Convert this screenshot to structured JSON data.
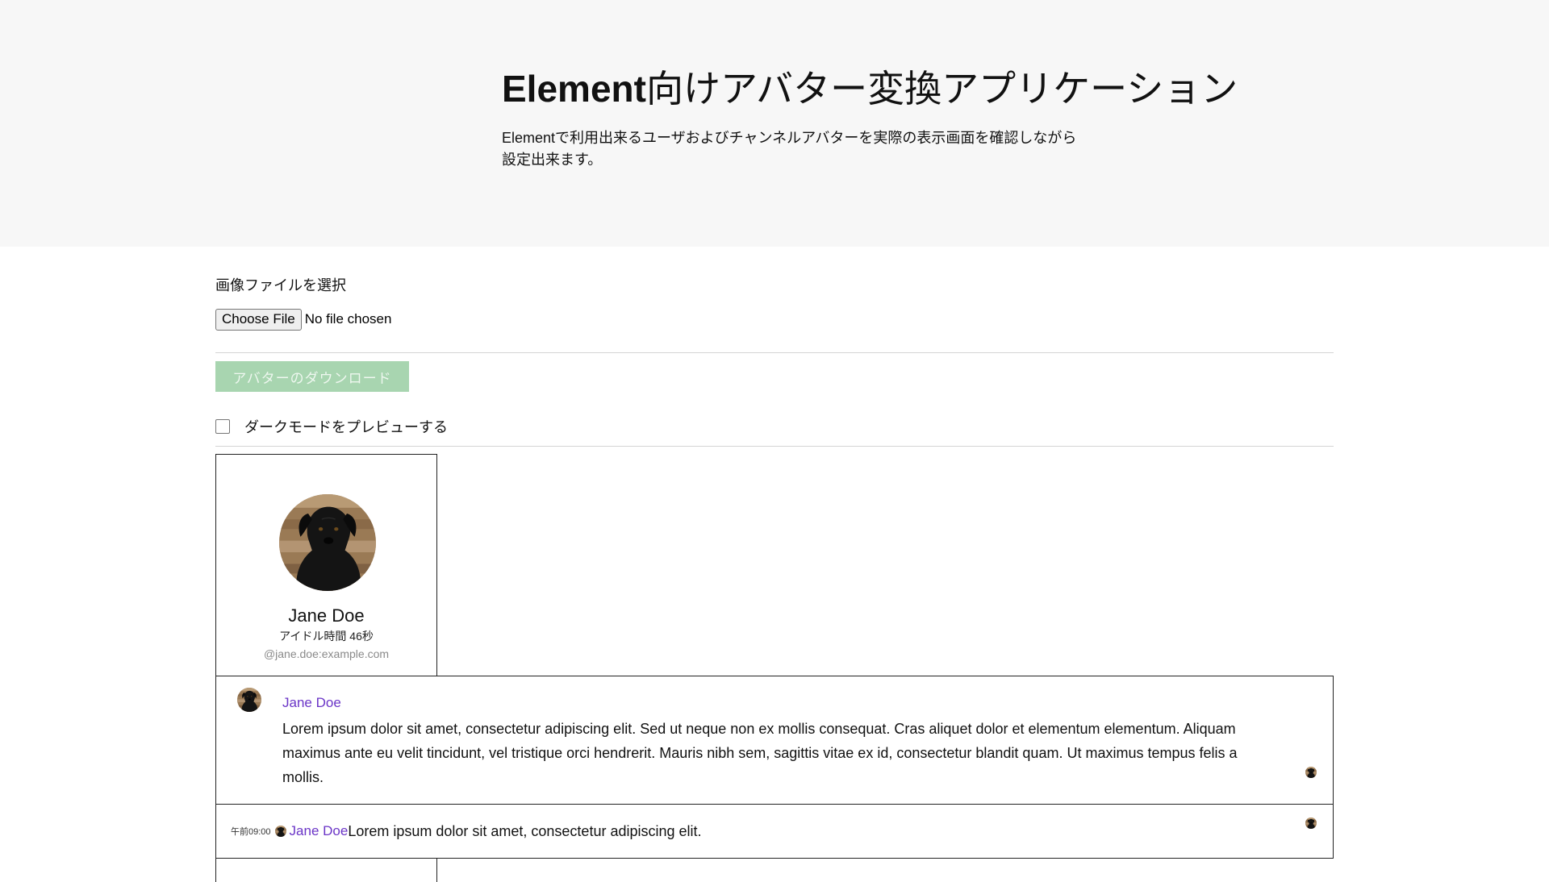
{
  "header": {
    "title_brand": "Element",
    "title_rest": "向けアバター変換アプリケーション",
    "description": "Elementで利用出来るユーザおよびチャンネルアバターを実際の表示画面を確認しながら設定出来ます。"
  },
  "file_input": {
    "label": "画像ファイルを選択",
    "button_label": "Choose File",
    "status": "No file chosen"
  },
  "download_button": {
    "label": "アバターのダウンロード",
    "disabled": true
  },
  "dark_mode": {
    "label": "ダークモードをプレビューする",
    "checked": false
  },
  "profile": {
    "avatar_icon": "dog-avatar-icon",
    "name": "Jane Doe",
    "idle": "アイドル時間 46秒",
    "user_id": "@jane.doe:example.com"
  },
  "messages": {
    "group": {
      "sender": "Jane Doe",
      "body": "Lorem ipsum dolor sit amet, consectetur adipiscing elit. Sed ut neque non ex mollis consequat. Cras aliquet dolor et elementum elementum. Aliquam maximus ante eu velit tincidunt, vel tristique orci hendrerit. Mauris nibh sem, sagittis vitae ex id, consectetur blandit quam. Ut maximus tempus felis a mollis."
    },
    "irc": {
      "time": "午前09:00",
      "sender": "Jane Doe",
      "body": "Lorem ipsum dolor sit amet, consectetur adipiscing elit."
    }
  },
  "colors": {
    "hero_background": "#f7f7f7",
    "sender_name": "#6b35c7",
    "download_disabled": "#a8d5b0",
    "border": "#222222"
  }
}
